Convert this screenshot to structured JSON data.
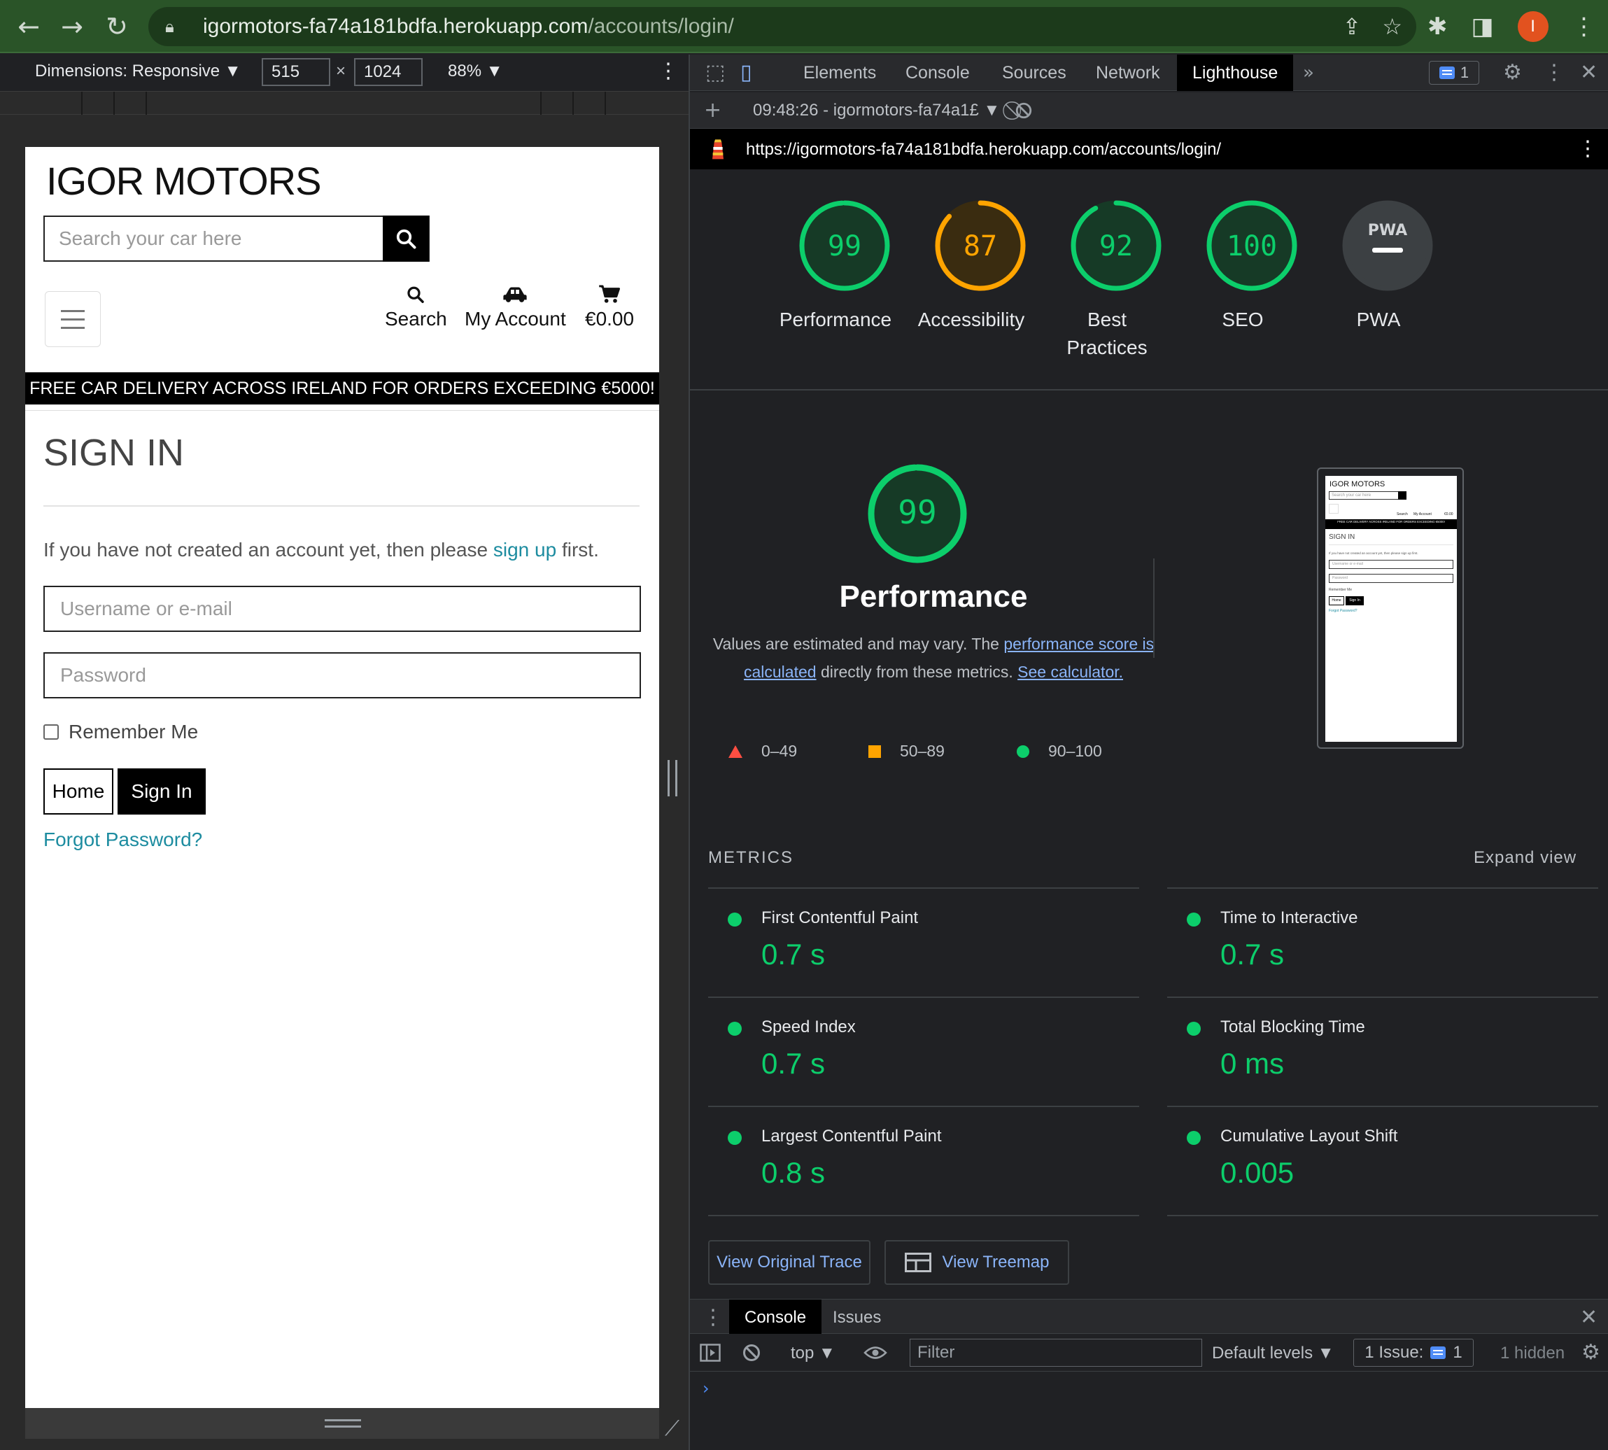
{
  "browser": {
    "url_host": "igormotors-fa74a181bdfa.herokuapp.com",
    "url_path": "/accounts/login/",
    "avatar_letter": "I"
  },
  "device_toolbar": {
    "dimensions_label": "Dimensions: Responsive ▼",
    "width": "515",
    "times": "×",
    "height": "1024",
    "zoom": "88% ▼"
  },
  "site": {
    "brand": "IGOR MOTORS",
    "search_placeholder": "Search your car here",
    "nav": {
      "search": "Search",
      "account": "My Account",
      "bag": "€0.00"
    },
    "banner": "FREE CAR DELIVERY ACROSS IRELAND FOR ORDERS EXCEEDING €5000!",
    "title": "SIGN IN",
    "intro_before": "If you have not created an account yet, then please ",
    "intro_link": "sign up",
    "intro_after": " first.",
    "username_placeholder": "Username or e-mail",
    "password_placeholder": "Password",
    "remember": "Remember Me",
    "home_button": "Home",
    "signin_button": "Sign In",
    "forgot": "Forgot Password?"
  },
  "devtools": {
    "tabs": [
      "Elements",
      "Console",
      "Sources",
      "Network",
      "Lighthouse"
    ],
    "active_tab": "Lighthouse",
    "issues_count": "1",
    "report_select": "09:48:26 - igormotors-fa74a1£ ▼",
    "report_url": "https://igormotors-fa74a181bdfa.herokuapp.com/accounts/login/",
    "scores": [
      {
        "label": "Performance",
        "value": "99",
        "score": 99,
        "color": "#0cce6b"
      },
      {
        "label": "Accessibility",
        "value": "87",
        "score": 87,
        "color": "#ffa400"
      },
      {
        "label": "Best Practices",
        "value": "92",
        "score": 92,
        "color": "#0cce6b"
      },
      {
        "label": "SEO",
        "value": "100",
        "score": 100,
        "color": "#0cce6b"
      },
      {
        "label": "PWA",
        "value": "PWA",
        "score": 0,
        "color": "#9aa0a6"
      }
    ],
    "perf_big_value": "99",
    "perf_big_title": "Performance",
    "perf_desc_1": "Values are estimated and may vary. The ",
    "perf_desc_link1": "performance score is calculated",
    "perf_desc_2": " directly from these metrics. ",
    "perf_desc_link2": "See calculator.",
    "legend": [
      "0–49",
      "50–89",
      "90–100"
    ],
    "metrics_heading": "METRICS",
    "expand_view": "Expand view",
    "metrics": [
      {
        "name": "First Contentful Paint",
        "value": "0.7 s"
      },
      {
        "name": "Time to Interactive",
        "value": "0.7 s"
      },
      {
        "name": "Speed Index",
        "value": "0.7 s"
      },
      {
        "name": "Total Blocking Time",
        "value": "0 ms"
      },
      {
        "name": "Largest Contentful Paint",
        "value": "0.8 s"
      },
      {
        "name": "Cumulative Layout Shift",
        "value": "0.005"
      }
    ],
    "view_trace": "View Original Trace",
    "view_treemap": "View Treemap",
    "drawer_tabs": [
      "Console",
      "Issues"
    ],
    "context": "top ▼",
    "filter_placeholder": "Filter",
    "levels": "Default levels ▼",
    "issue_label": "1 Issue:",
    "issue_count": "1",
    "hidden": "1 hidden",
    "prompt": "›"
  },
  "thumbnail": {
    "brand": "IGOR MOTORS",
    "search_placeholder": "Search your car here",
    "nav_search": "Search",
    "nav_account": "My Account",
    "nav_bag": "€0.00",
    "banner": "FREE CAR DELIVERY ACROSS IRELAND FOR ORDERS EXCEEDING €5000!",
    "title": "SIGN IN",
    "intro": "If you have not created an account yet, then please sign up first.",
    "username": "Username or e-mail",
    "password": "Password",
    "remember": "Remember Me",
    "home": "Home",
    "signin": "Sign In",
    "forgot": "Forgot Password?"
  }
}
